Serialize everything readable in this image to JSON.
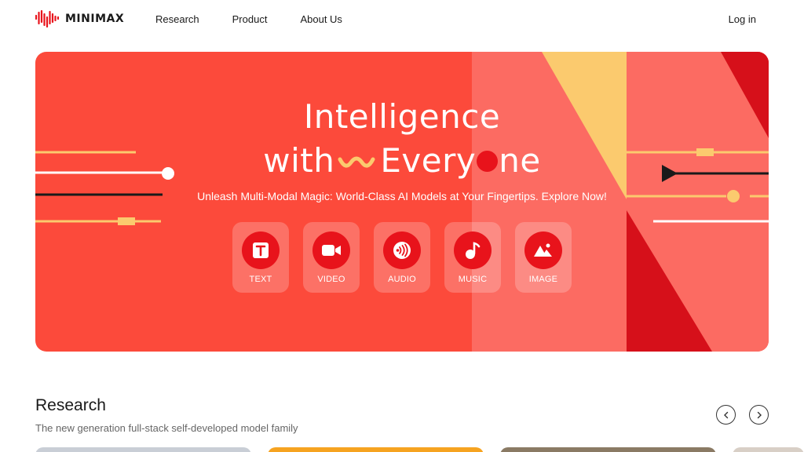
{
  "header": {
    "brand": "MINIMAX",
    "nav": [
      {
        "label": "Research"
      },
      {
        "label": "Product"
      },
      {
        "label": "About Us"
      }
    ],
    "login_label": "Log in"
  },
  "hero": {
    "title_line1": "Intelligence",
    "title_line2_a": "with",
    "title_line2_b": "Every",
    "title_line2_c": "ne",
    "subtitle": "Unleash Multi-Modal Magic: World-Class AI Models at Your Fingertips. Explore Now!",
    "modes": [
      {
        "label": "TEXT",
        "icon": "text-icon"
      },
      {
        "label": "VIDEO",
        "icon": "video-icon"
      },
      {
        "label": "AUDIO",
        "icon": "audio-icon"
      },
      {
        "label": "MUSIC",
        "icon": "music-icon"
      },
      {
        "label": "IMAGE",
        "icon": "image-icon"
      }
    ],
    "colors": {
      "background": "#fc4a3b",
      "accent_dark": "#e8131b",
      "accent_yellow": "#fbca6e",
      "panel_light": "#fc6b62"
    }
  },
  "research": {
    "title": "Research",
    "subtitle": "The new generation full-stack self-developed model family"
  }
}
